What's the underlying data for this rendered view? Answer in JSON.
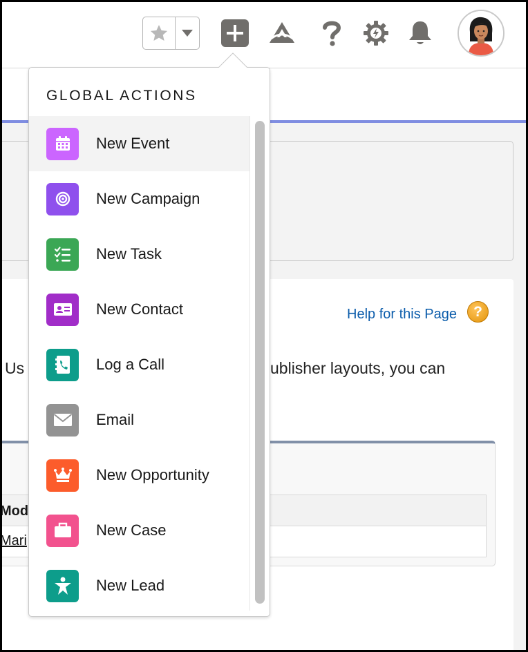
{
  "header": {
    "favorite_icon": "star-icon",
    "favorites_menu_icon": "chevron-down-icon",
    "global_actions_icon": "plus-icon",
    "trailhead_icon": "trailhead-icon",
    "help_icon": "question-icon",
    "setup_icon": "gear-icon",
    "notifications_icon": "bell-icon",
    "avatar_icon": "user-avatar"
  },
  "page": {
    "help_link": "Help for this Page",
    "help_icon_glyph": "?",
    "description_left": "Us",
    "description_right": "ublisher layouts, you can",
    "table_header": "Modi",
    "table_cell": "Mari"
  },
  "dropdown": {
    "title": "GLOBAL ACTIONS",
    "items": [
      {
        "label": "New Event",
        "icon": "calendar-icon",
        "color": "#cb65ff"
      },
      {
        "label": "New Campaign",
        "icon": "target-icon",
        "color": "#8f50ed"
      },
      {
        "label": "New Task",
        "icon": "checklist-icon",
        "color": "#3ba755"
      },
      {
        "label": "New Contact",
        "icon": "contact-card-icon",
        "color": "#a12dc8"
      },
      {
        "label": "Log a Call",
        "icon": "phone-icon",
        "color": "#0d9d8b"
      },
      {
        "label": "Email",
        "icon": "envelope-icon",
        "color": "#939393"
      },
      {
        "label": "New Opportunity",
        "icon": "crown-icon",
        "color": "#fc5c2b"
      },
      {
        "label": "New Case",
        "icon": "briefcase-icon",
        "color": "#f2528e"
      },
      {
        "label": "New Lead",
        "icon": "person-star-icon",
        "color": "#0d9d8b"
      }
    ]
  },
  "colors": {
    "accent_blue": "#7f8de1",
    "link": "#0b5cab",
    "header_icon": "#706e6b"
  }
}
